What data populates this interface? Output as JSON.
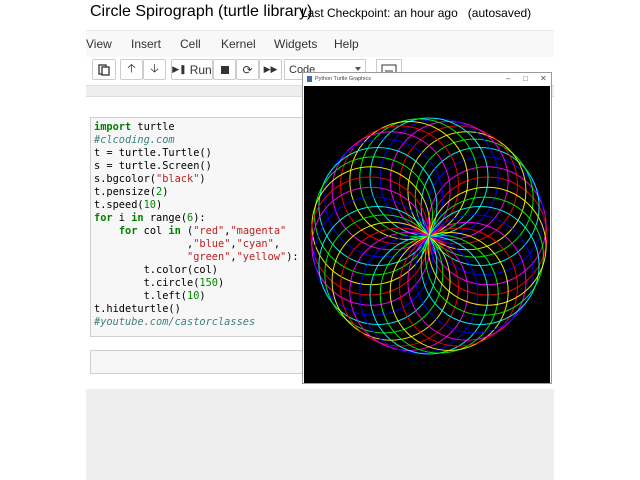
{
  "header": {
    "title": "Circle Spirograph (turtle library)",
    "checkpoint": "Last Checkpoint: an hour ago",
    "autosaved": "(autosaved)"
  },
  "menu": [
    "View",
    "Insert",
    "Cell",
    "Kernel",
    "Widgets",
    "Help"
  ],
  "toolbar": {
    "run_label": "Run",
    "cell_type": "Code"
  },
  "code_lines": [
    "import turtle",
    "#clcoding.com",
    "t = turtle.Turtle()",
    "s = turtle.Screen()",
    "s.bgcolor(\"black\")",
    "t.pensize(2)",
    "t.speed(10)",
    "for i in range(6):",
    "    for col in (\"red\",\"magenta\"",
    "               ,\"blue\",\"cyan\",",
    "               \"green\",\"yellow\"):",
    "        t.color(col)",
    "        t.circle(150)",
    "        t.left(10)",
    "t.hideturtle()",
    "#youtube.com/castorclasses"
  ],
  "turtle_window": {
    "title": "Python Turtle Graphics",
    "background": "#000000",
    "colors": [
      "#ff0000",
      "#ff00ff",
      "#0000ff",
      "#00ffff",
      "#00ff00",
      "#ffff00"
    ]
  }
}
